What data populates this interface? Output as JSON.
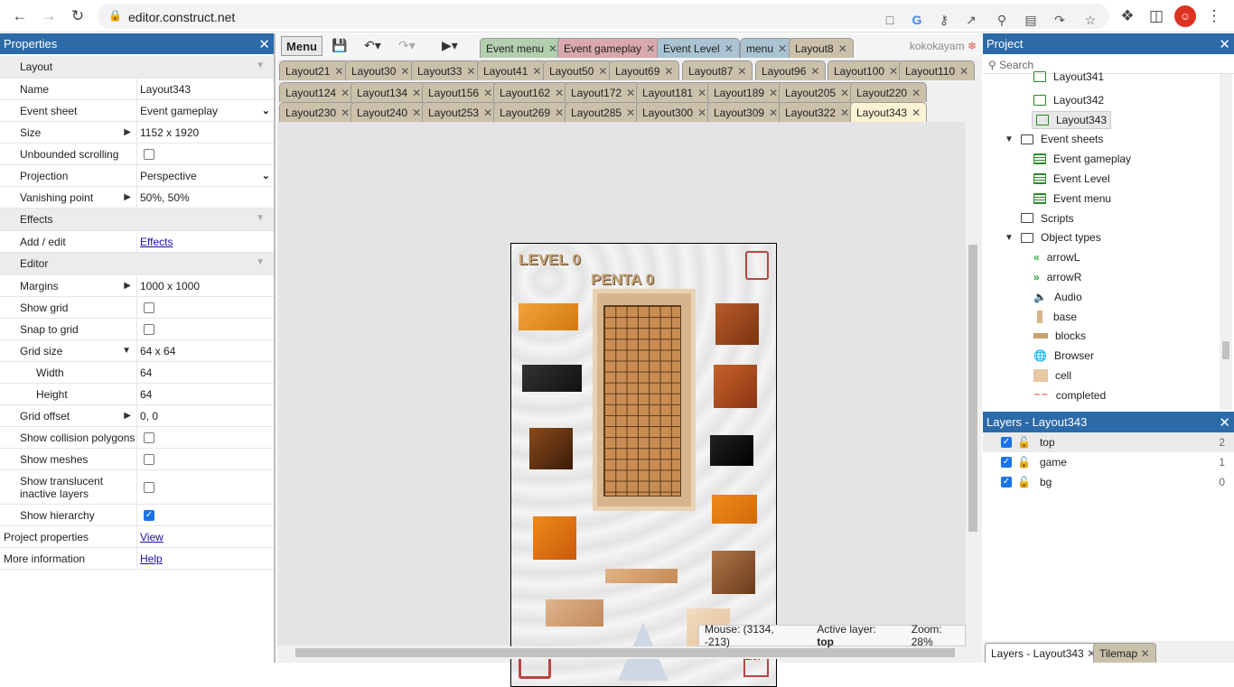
{
  "browser": {
    "url": "editor.construct.net"
  },
  "properties": {
    "title": "Properties",
    "rows": [
      {
        "type": "cat",
        "label": "Layout"
      },
      {
        "type": "text",
        "label": "Name",
        "value": "Layout343"
      },
      {
        "type": "select",
        "label": "Event sheet",
        "value": "Event gameplay"
      },
      {
        "type": "expand",
        "label": "Size",
        "value": "1152 x 1920"
      },
      {
        "type": "check",
        "label": "Unbounded scrolling",
        "checked": false
      },
      {
        "type": "select",
        "label": "Projection",
        "value": "Perspective"
      },
      {
        "type": "expand",
        "label": "Vanishing point",
        "value": "50%, 50%"
      },
      {
        "type": "cat",
        "label": "Effects"
      },
      {
        "type": "link",
        "label": "Add / edit",
        "value": "Effects"
      },
      {
        "type": "cat",
        "label": "Editor"
      },
      {
        "type": "expand",
        "label": "Margins",
        "value": "1000 x 1000"
      },
      {
        "type": "check",
        "label": "Show grid",
        "checked": false
      },
      {
        "type": "check",
        "label": "Snap to grid",
        "checked": false
      },
      {
        "type": "collapse",
        "label": "Grid size",
        "value": "64 x 64"
      },
      {
        "type": "sub",
        "label": "Width",
        "value": "64"
      },
      {
        "type": "sub",
        "label": "Height",
        "value": "64"
      },
      {
        "type": "expand",
        "label": "Grid offset",
        "value": "0, 0"
      },
      {
        "type": "check",
        "label": "Show collision polygons",
        "checked": false
      },
      {
        "type": "check",
        "label": "Show meshes",
        "checked": false
      },
      {
        "type": "check2",
        "label": "Show translucent inactive layers",
        "checked": false
      },
      {
        "type": "check",
        "label": "Show hierarchy",
        "checked": true
      },
      {
        "type": "toplink",
        "label": "Project properties",
        "value": "View"
      },
      {
        "type": "toplink",
        "label": "More information",
        "value": "Help"
      }
    ]
  },
  "toolbar": {
    "menu_label": "Menu",
    "user": "kokokayam"
  },
  "tabs_row1": [
    {
      "label": "Event menu",
      "style": "green"
    },
    {
      "label": "Event gameplay",
      "style": "pink"
    },
    {
      "label": "Event Level",
      "style": "blue"
    },
    {
      "label": "menu",
      "style": "blue"
    },
    {
      "label": "Layout8",
      "style": "plain"
    }
  ],
  "tabs_row2": [
    "Layout21",
    "Layout30",
    "Layout33",
    "Layout41",
    "Layout50",
    "Layout69",
    "Layout87",
    "Layout96",
    "Layout100",
    "Layout110"
  ],
  "tabs_row3": [
    "Layout124",
    "Layout134",
    "Layout156",
    "Layout162",
    "Layout172",
    "Layout181",
    "Layout189",
    "Layout205",
    "Layout220"
  ],
  "tabs_row4": [
    "Layout230",
    "Layout240",
    "Layout253",
    "Layout269",
    "Layout285",
    "Layout300",
    "Layout309",
    "Layout322",
    "Layout343"
  ],
  "active_tab": "Layout343",
  "game": {
    "level_text": "LEVEL 0",
    "penta_text": "PENTA 0"
  },
  "status": {
    "mouse": "Mouse: (3134, -213)",
    "active_layer_prefix": "Active layer:",
    "active_layer": "top",
    "zoom": "Zoom: 28%"
  },
  "project": {
    "title": "Project",
    "search_placeholder": "Search",
    "items": [
      {
        "label": "Layout341",
        "kind": "layout",
        "level": 2
      },
      {
        "label": "Layout342",
        "kind": "layout",
        "level": 2
      },
      {
        "label": "Layout343",
        "kind": "layout",
        "level": 2,
        "selected": true
      },
      {
        "label": "Event sheets",
        "kind": "folder",
        "level": 1,
        "expanded": true
      },
      {
        "label": "Event gameplay",
        "kind": "sheet",
        "level": 2
      },
      {
        "label": "Event Level",
        "kind": "sheet",
        "level": 2
      },
      {
        "label": "Event menu",
        "kind": "sheet",
        "level": 2
      },
      {
        "label": "Scripts",
        "kind": "folder",
        "level": 1
      },
      {
        "label": "Object types",
        "kind": "folder",
        "level": 1,
        "expanded": true
      },
      {
        "label": "arrowL",
        "kind": "arrowL",
        "level": 2
      },
      {
        "label": "arrowR",
        "kind": "arrowR",
        "level": 2
      },
      {
        "label": "Audio",
        "kind": "audio",
        "level": 2
      },
      {
        "label": "base",
        "kind": "base",
        "level": 2
      },
      {
        "label": "blocks",
        "kind": "blocks",
        "level": 2
      },
      {
        "label": "Browser",
        "kind": "browser",
        "level": 2
      },
      {
        "label": "cell",
        "kind": "cell",
        "level": 2
      },
      {
        "label": "completed",
        "kind": "completed",
        "level": 2
      }
    ]
  },
  "layers": {
    "title": "Layers - Layout343",
    "items": [
      {
        "name": "top",
        "index": "2"
      },
      {
        "name": "game",
        "index": "1"
      },
      {
        "name": "bg",
        "index": "0"
      }
    ],
    "bottom_tabs": [
      "Layers - Layout343",
      "Tilemap"
    ]
  },
  "colors": {
    "panel_header": "#2c6aa8",
    "active_tab": "#fbf3d3"
  }
}
